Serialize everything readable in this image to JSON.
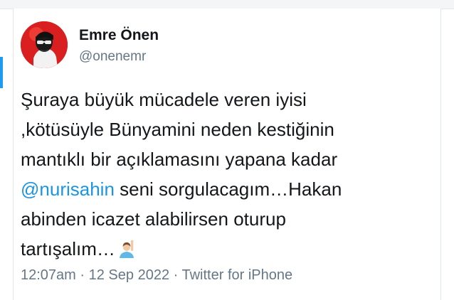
{
  "tweet": {
    "author": {
      "display_name": "Emre Önen",
      "handle": "@onenemr"
    },
    "text_lines": {
      "l1": "Şuraya büyük mücadele veren iyisi",
      "l2": ",kötüsüyle Bünyamini neden kestiğinin",
      "l3": "mantıklı bir açıklamasını yapana kadar",
      "l4_mention": "@nurisahin",
      "l4_rest": " seni sorgulacagım…Hakan",
      "l5": "abinden icazet alabilirsen oturup",
      "l6": "tartışalım…"
    },
    "emoji": "raising-hand-emoji",
    "meta": {
      "time": "12:07am",
      "separator1": " · ",
      "date": "12 Sep 2022",
      "separator2": " · ",
      "source": "Twitter for iPhone"
    }
  },
  "colors": {
    "mention": "#1b95e0",
    "secondary_text": "#657786",
    "primary_text": "#14171a",
    "avatar_bg": "#d91f1f"
  }
}
